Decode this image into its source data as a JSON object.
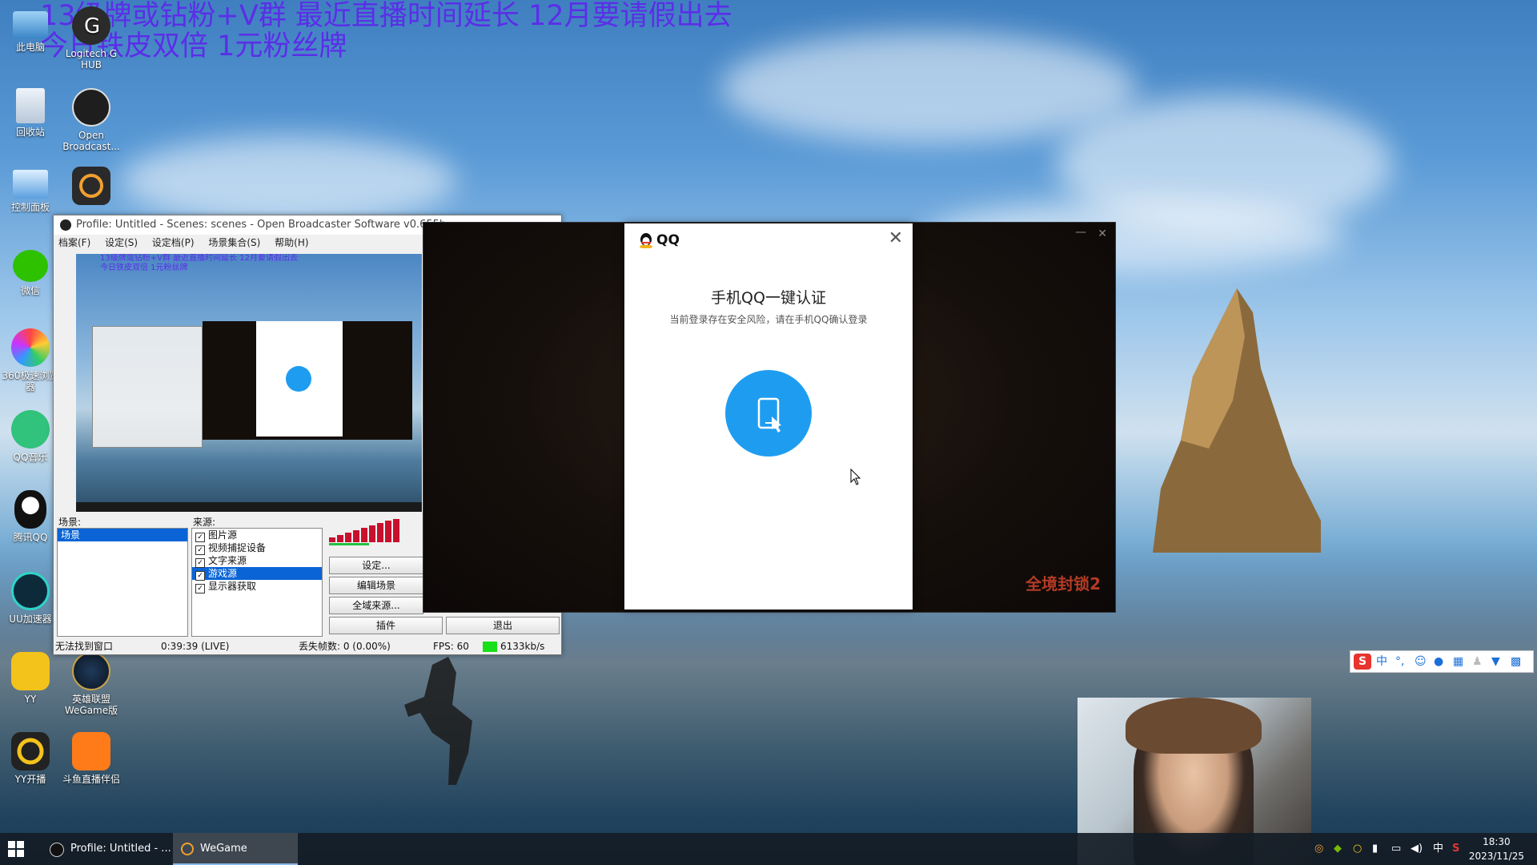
{
  "overlay": {
    "line1": "13级牌或钻粉+V群  最近直播时间延长 12月要请假出去",
    "line2": "今日铁皮双倍 1元粉丝牌"
  },
  "desktop_icons": [
    {
      "label": "此电脑",
      "icon": "computer-icon"
    },
    {
      "label": "Logitech G HUB",
      "icon": "logitech-icon"
    },
    {
      "label": "回收站",
      "icon": "recycle-bin-icon"
    },
    {
      "label": "Open Broadcast...",
      "icon": "obs-icon"
    },
    {
      "label": "控制面板",
      "icon": "control-panel-icon"
    },
    {
      "label": "",
      "icon": "wegame-icon"
    },
    {
      "label": "微信",
      "icon": "wechat-icon"
    },
    {
      "label": "360极速浏览器",
      "icon": "browser-360-icon"
    },
    {
      "label": "QQ音乐",
      "icon": "qq-music-icon"
    },
    {
      "label": "腾讯QQ",
      "icon": "qq-icon"
    },
    {
      "label": "UU加速器",
      "icon": "uu-icon"
    },
    {
      "label": "YY",
      "icon": "yy-icon"
    },
    {
      "label": "英雄联盟WeGame版",
      "icon": "lol-icon"
    },
    {
      "label": "YY开播",
      "icon": "yy-live-icon"
    },
    {
      "label": "斗鱼直播伴侣",
      "icon": "douyu-icon"
    }
  ],
  "obs": {
    "title": "Profile: Untitled - Scenes: scenes - Open Broadcaster Software v0.655b",
    "menu": [
      "档案(F)",
      "设定(S)",
      "设定档(P)",
      "场景集合(S)",
      "帮助(H)"
    ],
    "scenes_label": "场景:",
    "sources_label": "来源:",
    "scenes": [
      "场景"
    ],
    "sources": [
      {
        "name": "图片源",
        "checked": true,
        "selected": false
      },
      {
        "name": "视频捕捉设备",
        "checked": true,
        "selected": false
      },
      {
        "name": "文字来源",
        "checked": true,
        "selected": false
      },
      {
        "name": "游戏源",
        "checked": true,
        "selected": true
      },
      {
        "name": "显示器获取",
        "checked": true,
        "selected": false
      }
    ],
    "buttons": {
      "settings": "设定...",
      "edit_scene": "编辑场景",
      "global_sources": "全域来源...",
      "plugins": "插件",
      "exit": "退出"
    },
    "status": {
      "window": "无法找到窗口",
      "time": "0:39:39 (LIVE)",
      "dropped": "丢失帧数: 0 (0.00%)",
      "fps": "FPS: 60",
      "bitrate": "6133kb/s"
    },
    "preview_overlay1": "13级牌或钻粉+V群  最近直播时间延长 12月要请假出去",
    "preview_overlay2": "今日铁皮双倍 1元粉丝牌"
  },
  "game": {
    "logo": "全境封锁2"
  },
  "qq_dialog": {
    "title": "QQ",
    "heading": "手机QQ一键认证",
    "subtitle": "当前登录存在安全风险，请在手机QQ确认登录"
  },
  "ime": {
    "label": "中"
  },
  "taskbar": {
    "items": [
      {
        "label": "Profile: Untitled - ...",
        "icon": "obs-icon",
        "active": false
      },
      {
        "label": "WeGame",
        "icon": "wegame-icon",
        "active": true
      }
    ],
    "tray_lang": "中",
    "time": "18:30",
    "date": "2023/11/25"
  },
  "colors": {
    "overlay_text": "#5b2ee8",
    "qq_blue": "#1e9df0",
    "obs_selection": "#0a64d6"
  }
}
